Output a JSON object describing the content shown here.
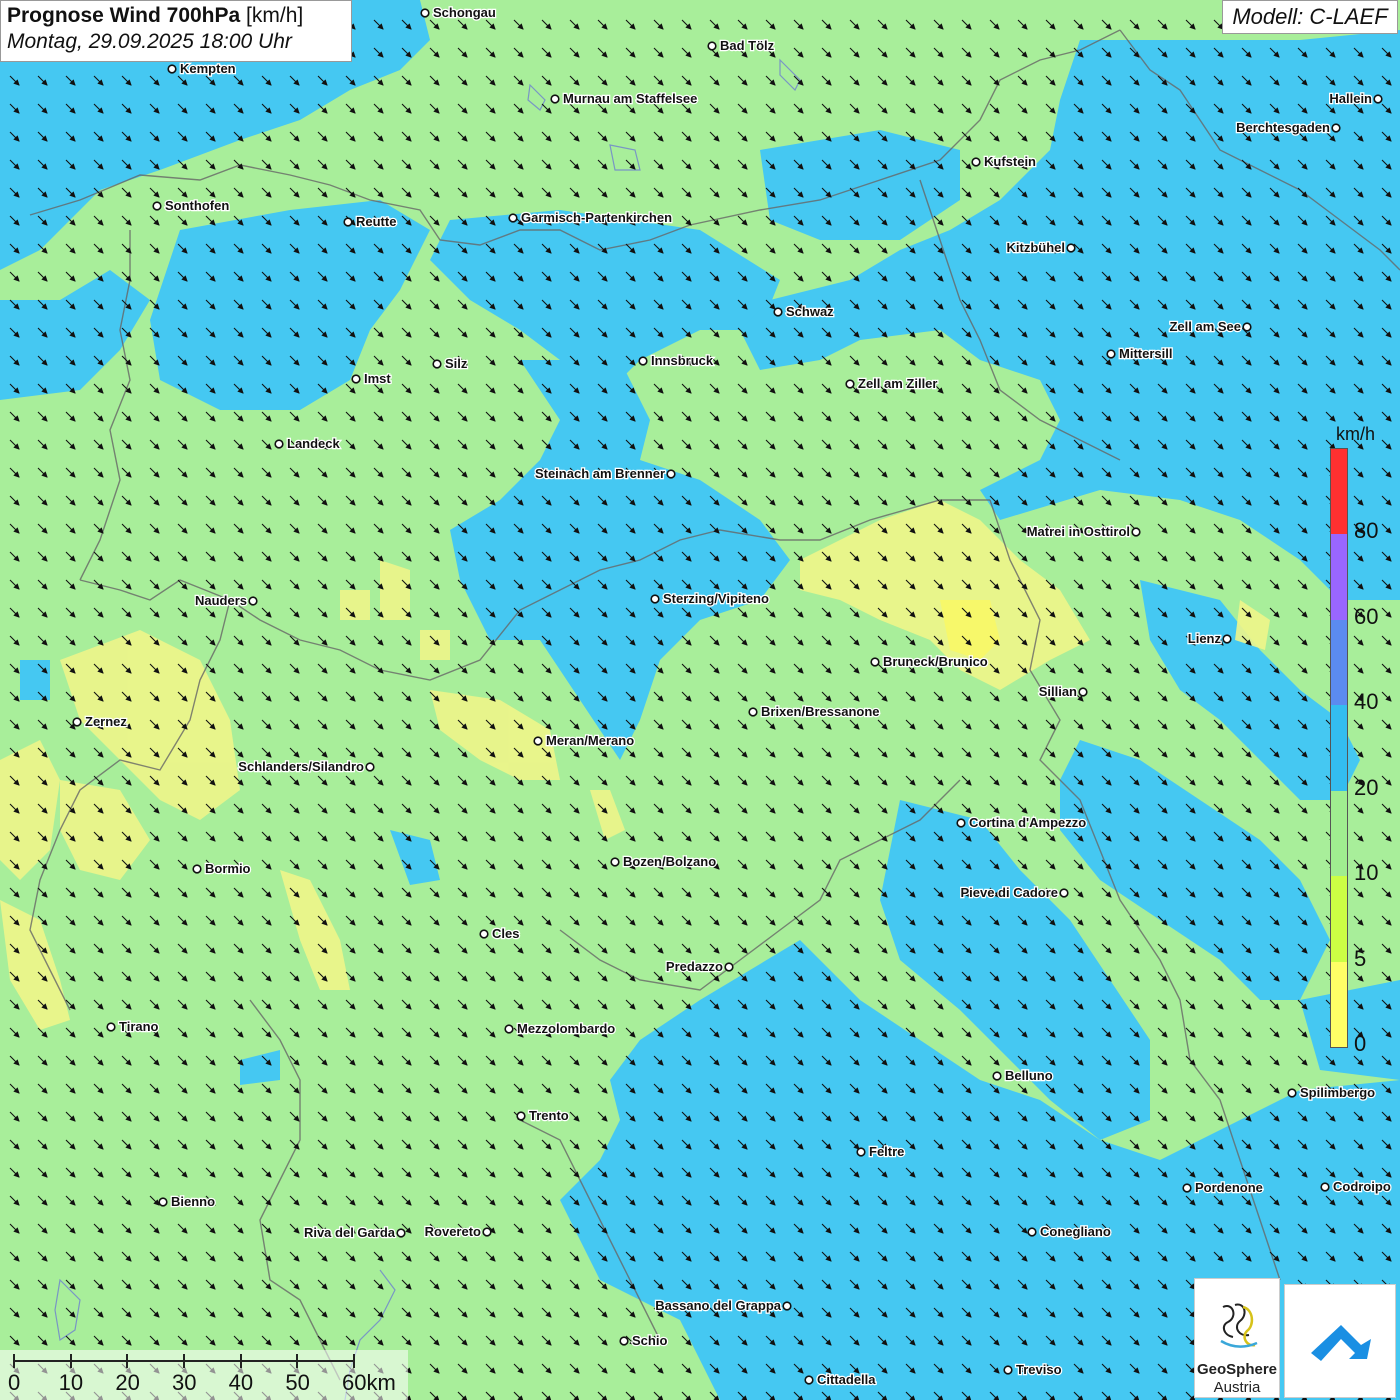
{
  "header": {
    "title_bold": "Prognose Wind 700hPa",
    "title_unit": "[km/h]",
    "datetime": "Montag, 29.09.2025 18:00 Uhr",
    "model": "Modell: C-LAEF"
  },
  "legend": {
    "unit": "km/h",
    "ticks": [
      "80",
      "60",
      "40",
      "20",
      "10",
      "5",
      "0"
    ],
    "colors": [
      "#ff3030",
      "#9966ff",
      "#5b8bf0",
      "#33bdf0",
      "#a0ee90",
      "#ccff44",
      "#ffff66"
    ]
  },
  "scale_bar": {
    "labels": [
      "0",
      "10",
      "20",
      "30",
      "40",
      "50",
      "60km"
    ]
  },
  "logos": {
    "geosphere_line1": "GeoSphere",
    "geosphere_line2": "Austria",
    "app_icon": "cloud-arrow-icon",
    "geosphere_icon": "geosphere-logo-icon"
  },
  "map_colors": {
    "calm_green": "#a8ee9a",
    "wind_blue": "#45c8f2",
    "light_yellow": "#eef58a",
    "border_gray": "#666666"
  },
  "wind_arrows": {
    "direction": "south-east",
    "icon": "wind-arrow-icon"
  },
  "cities": [
    {
      "name": "Schongau"
    },
    {
      "name": "Bad Tölz"
    },
    {
      "name": "Kempten"
    },
    {
      "name": "Murnau am Staffelsee"
    },
    {
      "name": "Hallein"
    },
    {
      "name": "Berchtesgaden"
    },
    {
      "name": "Kufstein"
    },
    {
      "name": "Sonthofen"
    },
    {
      "name": "Reutte"
    },
    {
      "name": "Garmisch-Partenkirchen"
    },
    {
      "name": "Kitzbühel"
    },
    {
      "name": "Schwaz"
    },
    {
      "name": "Zell am See"
    },
    {
      "name": "Mittersill"
    },
    {
      "name": "Innsbruck"
    },
    {
      "name": "Silz"
    },
    {
      "name": "Imst"
    },
    {
      "name": "Zell am Ziller"
    },
    {
      "name": "Landeck"
    },
    {
      "name": "Steinach am Brenner"
    },
    {
      "name": "Matrei in Osttirol"
    },
    {
      "name": "Nauders"
    },
    {
      "name": "Sterzing/Vipiteno"
    },
    {
      "name": "Lienz"
    },
    {
      "name": "Bruneck/Brunico"
    },
    {
      "name": "Sillian"
    },
    {
      "name": "Brixen/Bressanone"
    },
    {
      "name": "Zernez"
    },
    {
      "name": "Meran/Merano"
    },
    {
      "name": "Schlanders/Silandro"
    },
    {
      "name": "Cortina d'Ampezzo"
    },
    {
      "name": "Bozen/Bolzano"
    },
    {
      "name": "Bormio"
    },
    {
      "name": "Pieve di Cadore"
    },
    {
      "name": "Cles"
    },
    {
      "name": "Predazzo"
    },
    {
      "name": "Tirano"
    },
    {
      "name": "Mezzolombardo"
    },
    {
      "name": "Belluno"
    },
    {
      "name": "Spilimbergo"
    },
    {
      "name": "Trento"
    },
    {
      "name": "Feltre"
    },
    {
      "name": "Pordenone"
    },
    {
      "name": "Codroipo"
    },
    {
      "name": "Bienno"
    },
    {
      "name": "Riva del Garda"
    },
    {
      "name": "Rovereto"
    },
    {
      "name": "Conegliano"
    },
    {
      "name": "Bassano del Grappa"
    },
    {
      "name": "Schio"
    },
    {
      "name": "Treviso"
    },
    {
      "name": "Cittadella"
    }
  ]
}
